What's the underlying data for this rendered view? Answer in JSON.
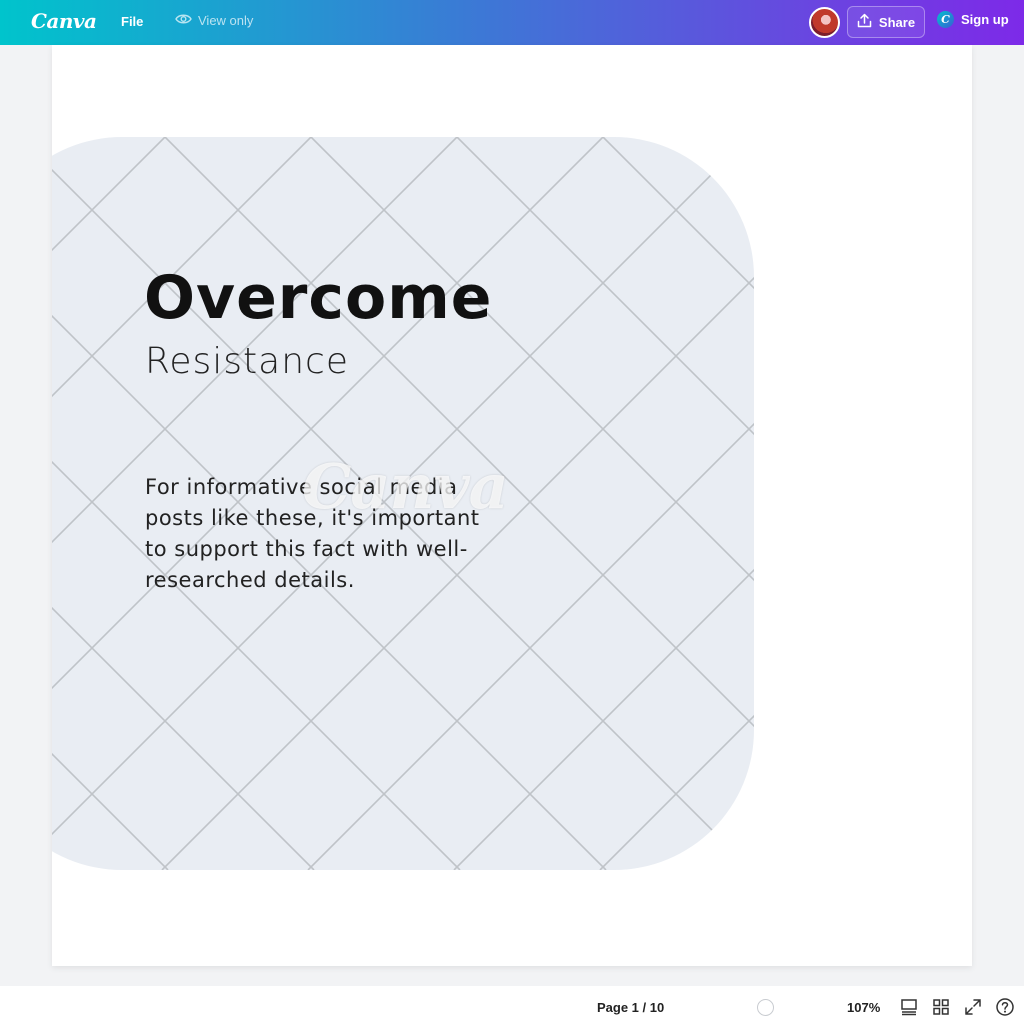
{
  "topbar": {
    "logo": "Canva",
    "file_label": "File",
    "view_only_label": "View only",
    "share_label": "Share",
    "signup_label": "Sign up",
    "signup_icon_letter": "C"
  },
  "design": {
    "heading": "Overcome",
    "subheading": "Resistance",
    "body": "For informative social media posts like these, it's important to support this fact with well-researched details.",
    "watermark": "Canva"
  },
  "bottombar": {
    "page_indicator": "Page 1 / 10",
    "zoom": "107%"
  },
  "icons": [
    "eye-icon",
    "share-upload-icon",
    "canva-c-icon",
    "notes-layout-icon",
    "grid-view-icon",
    "fullscreen-icon",
    "help-icon"
  ],
  "colors": {
    "gradient_start": "#00c4cc",
    "gradient_end": "#7d2ae8",
    "tile_background": "#e9edf3",
    "tile_lines": "#bfc3c8"
  }
}
